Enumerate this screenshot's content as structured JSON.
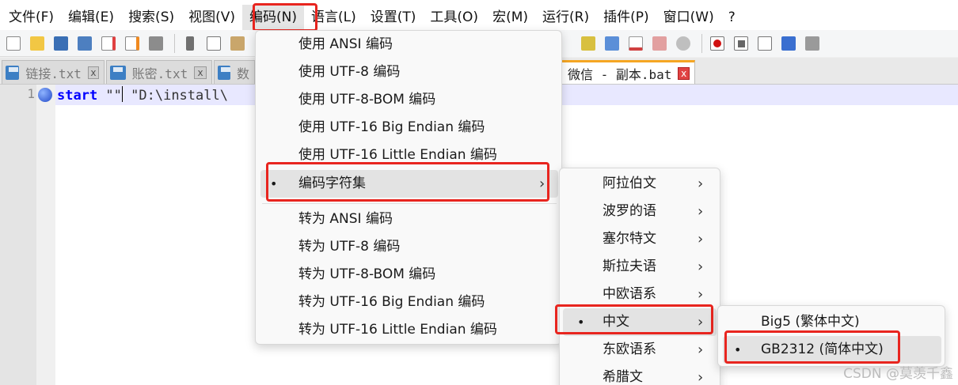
{
  "menubar": [
    {
      "label": "文件(F)"
    },
    {
      "label": "编辑(E)"
    },
    {
      "label": "搜索(S)"
    },
    {
      "label": "视图(V)"
    },
    {
      "label": "编码(N)"
    },
    {
      "label": "语言(L)"
    },
    {
      "label": "设置(T)"
    },
    {
      "label": "工具(O)"
    },
    {
      "label": "宏(M)"
    },
    {
      "label": "运行(R)"
    },
    {
      "label": "插件(P)"
    },
    {
      "label": "窗口(W)"
    },
    {
      "label": "?"
    }
  ],
  "tabs": [
    {
      "label": "链接.txt"
    },
    {
      "label": "账密.txt"
    },
    {
      "label": "数"
    },
    {
      "label": "微信 - 副本.bat"
    }
  ],
  "editor": {
    "line_number": "1",
    "keyword": "start",
    "text_before_caret": " \"\"",
    "text_after_caret": " \"D:\\install\\"
  },
  "encoding_menu": {
    "items": [
      {
        "label": "使用 ANSI 编码"
      },
      {
        "label": "使用 UTF-8 编码"
      },
      {
        "label": "使用 UTF-8-BOM 编码"
      },
      {
        "label": "使用 UTF-16 Big Endian 编码"
      },
      {
        "label": "使用 UTF-16 Little Endian 编码"
      },
      {
        "label": "编码字符集"
      },
      {
        "label": "转为 ANSI 编码"
      },
      {
        "label": "转为 UTF-8 编码"
      },
      {
        "label": "转为 UTF-8-BOM 编码"
      },
      {
        "label": "转为 UTF-16 Big Endian 编码"
      },
      {
        "label": "转为 UTF-16 Little Endian 编码"
      }
    ]
  },
  "charset_menu": {
    "items": [
      {
        "label": "阿拉伯文"
      },
      {
        "label": "波罗的语"
      },
      {
        "label": "塞尔特文"
      },
      {
        "label": "斯拉夫语"
      },
      {
        "label": "中欧语系"
      },
      {
        "label": "中文"
      },
      {
        "label": "东欧语系"
      },
      {
        "label": "希腊文"
      }
    ]
  },
  "chinese_menu": {
    "items": [
      {
        "label": "Big5 (繁体中文)"
      },
      {
        "label": "GB2312 (简体中文)"
      }
    ]
  },
  "glyphs": {
    "bullet": "•",
    "arrow": "›",
    "close": "x"
  },
  "watermark": "CSDN @莫羡千鑫",
  "colors": {
    "highlight_box": "#e8251f",
    "active_tab_accent": "#f5a623",
    "keyword": "#0000ff"
  }
}
